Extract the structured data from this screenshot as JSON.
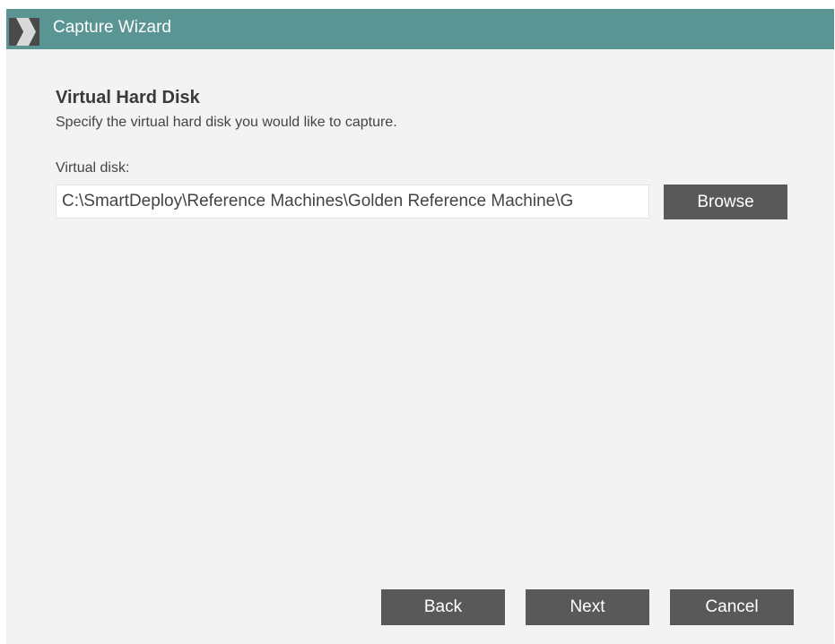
{
  "window": {
    "title": "Capture Wizard",
    "accent_color": "#5a9593",
    "icon": "chevron-logo-icon"
  },
  "page": {
    "title": "Virtual Hard Disk",
    "description": "Specify the virtual hard disk you would like to capture."
  },
  "virtual_disk": {
    "label": "Virtual disk:",
    "value": "C:\\SmartDeploy\\Reference Machines\\Golden Reference Machine\\G",
    "browse_label": "Browse"
  },
  "footer": {
    "back_label": "Back",
    "next_label": "Next",
    "cancel_label": "Cancel"
  }
}
